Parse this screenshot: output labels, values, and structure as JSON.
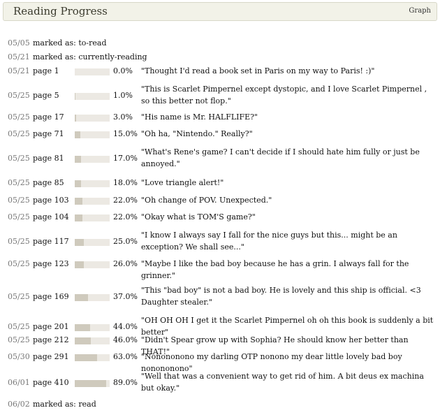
{
  "header": {
    "title": "Reading Progress",
    "graph_link": "Graph"
  },
  "entries": [
    {
      "date": "05/05",
      "kind": "status",
      "text": "marked as: to-read"
    },
    {
      "date": "05/21",
      "kind": "status",
      "text": "marked as: currently-reading"
    },
    {
      "date": "05/21",
      "kind": "progress",
      "page": "page 1",
      "percent_value": 0.0,
      "percent_text": "0.0%",
      "comment": "\"Thought I'd read a book set in Paris on my way to Paris! :)\""
    },
    {
      "date": "05/25",
      "kind": "progress",
      "page": "page 5",
      "percent_value": 1.0,
      "percent_text": "1.0%",
      "comment": "\"This is Scarlet Pimpernel except dystopic, and I love Scarlet Pimpernel , so this better not flop.\""
    },
    {
      "date": "05/25",
      "kind": "progress",
      "page": "page 17",
      "percent_value": 3.0,
      "percent_text": "3.0%",
      "comment": "\"His name is Mr. HALFLIFE?\""
    },
    {
      "date": "05/25",
      "kind": "progress",
      "page": "page 71",
      "percent_value": 15.0,
      "percent_text": "15.0%",
      "comment": "\"Oh ha, \"Nintendo.\" Really?\""
    },
    {
      "date": "05/25",
      "kind": "progress",
      "page": "page 81",
      "percent_value": 17.0,
      "percent_text": "17.0%",
      "comment": "\"What's Rene's game? I can't decide if I should hate him fully or just be annoyed.\""
    },
    {
      "date": "05/25",
      "kind": "progress",
      "page": "page 85",
      "percent_value": 18.0,
      "percent_text": "18.0%",
      "comment": "\"Love triangle alert!\""
    },
    {
      "date": "05/25",
      "kind": "progress",
      "page": "page 103",
      "percent_value": 22.0,
      "percent_text": "22.0%",
      "comment": "\"Oh change of POV. Unexpected.\""
    },
    {
      "date": "05/25",
      "kind": "progress",
      "page": "page 104",
      "percent_value": 22.0,
      "percent_text": "22.0%",
      "comment": "\"Okay what is TOM'S game?\""
    },
    {
      "date": "05/25",
      "kind": "progress",
      "page": "page 117",
      "percent_value": 25.0,
      "percent_text": "25.0%",
      "comment": "\"I know I always say I fall for the nice guys but this... might be an exception? We shall see...\""
    },
    {
      "date": "05/25",
      "kind": "progress",
      "page": "page 123",
      "percent_value": 26.0,
      "percent_text": "26.0%",
      "comment": "\"Maybe I like the bad boy because he has a grin. I always fall for the grinner.\""
    },
    {
      "date": "05/25",
      "kind": "progress",
      "page": "page 169",
      "percent_value": 37.0,
      "percent_text": "37.0%",
      "comment": "\"This \"bad boy\" is not a bad boy. He is lovely and this ship is official. <3 Daughter stealer.\""
    },
    {
      "date": "05/25",
      "kind": "progress",
      "page": "page 201",
      "percent_value": 44.0,
      "percent_text": "44.0%",
      "comment": "\"OH OH OH I get it the Scarlet Pimpernel oh oh this book is suddenly a bit better\""
    },
    {
      "date": "05/25",
      "kind": "progress",
      "page": "page 212",
      "percent_value": 46.0,
      "percent_text": "46.0%",
      "comment": "\"Didn't Spear grow up with Sophia? He should know her better than THAT!\""
    },
    {
      "date": "05/30",
      "kind": "progress",
      "page": "page 291",
      "percent_value": 63.0,
      "percent_text": "63.0%",
      "comment": "\"Nonononono my darling OTP nonono my dear little lovely bad boy nonononono\""
    },
    {
      "date": "06/01",
      "kind": "progress",
      "page": "page 410",
      "percent_value": 89.0,
      "percent_text": "89.0%",
      "comment": "\"Well that was a convenient way to get rid of him. A bit deus ex machina but okay.\""
    },
    {
      "date": "06/02",
      "kind": "status",
      "text": "marked as: read"
    }
  ]
}
